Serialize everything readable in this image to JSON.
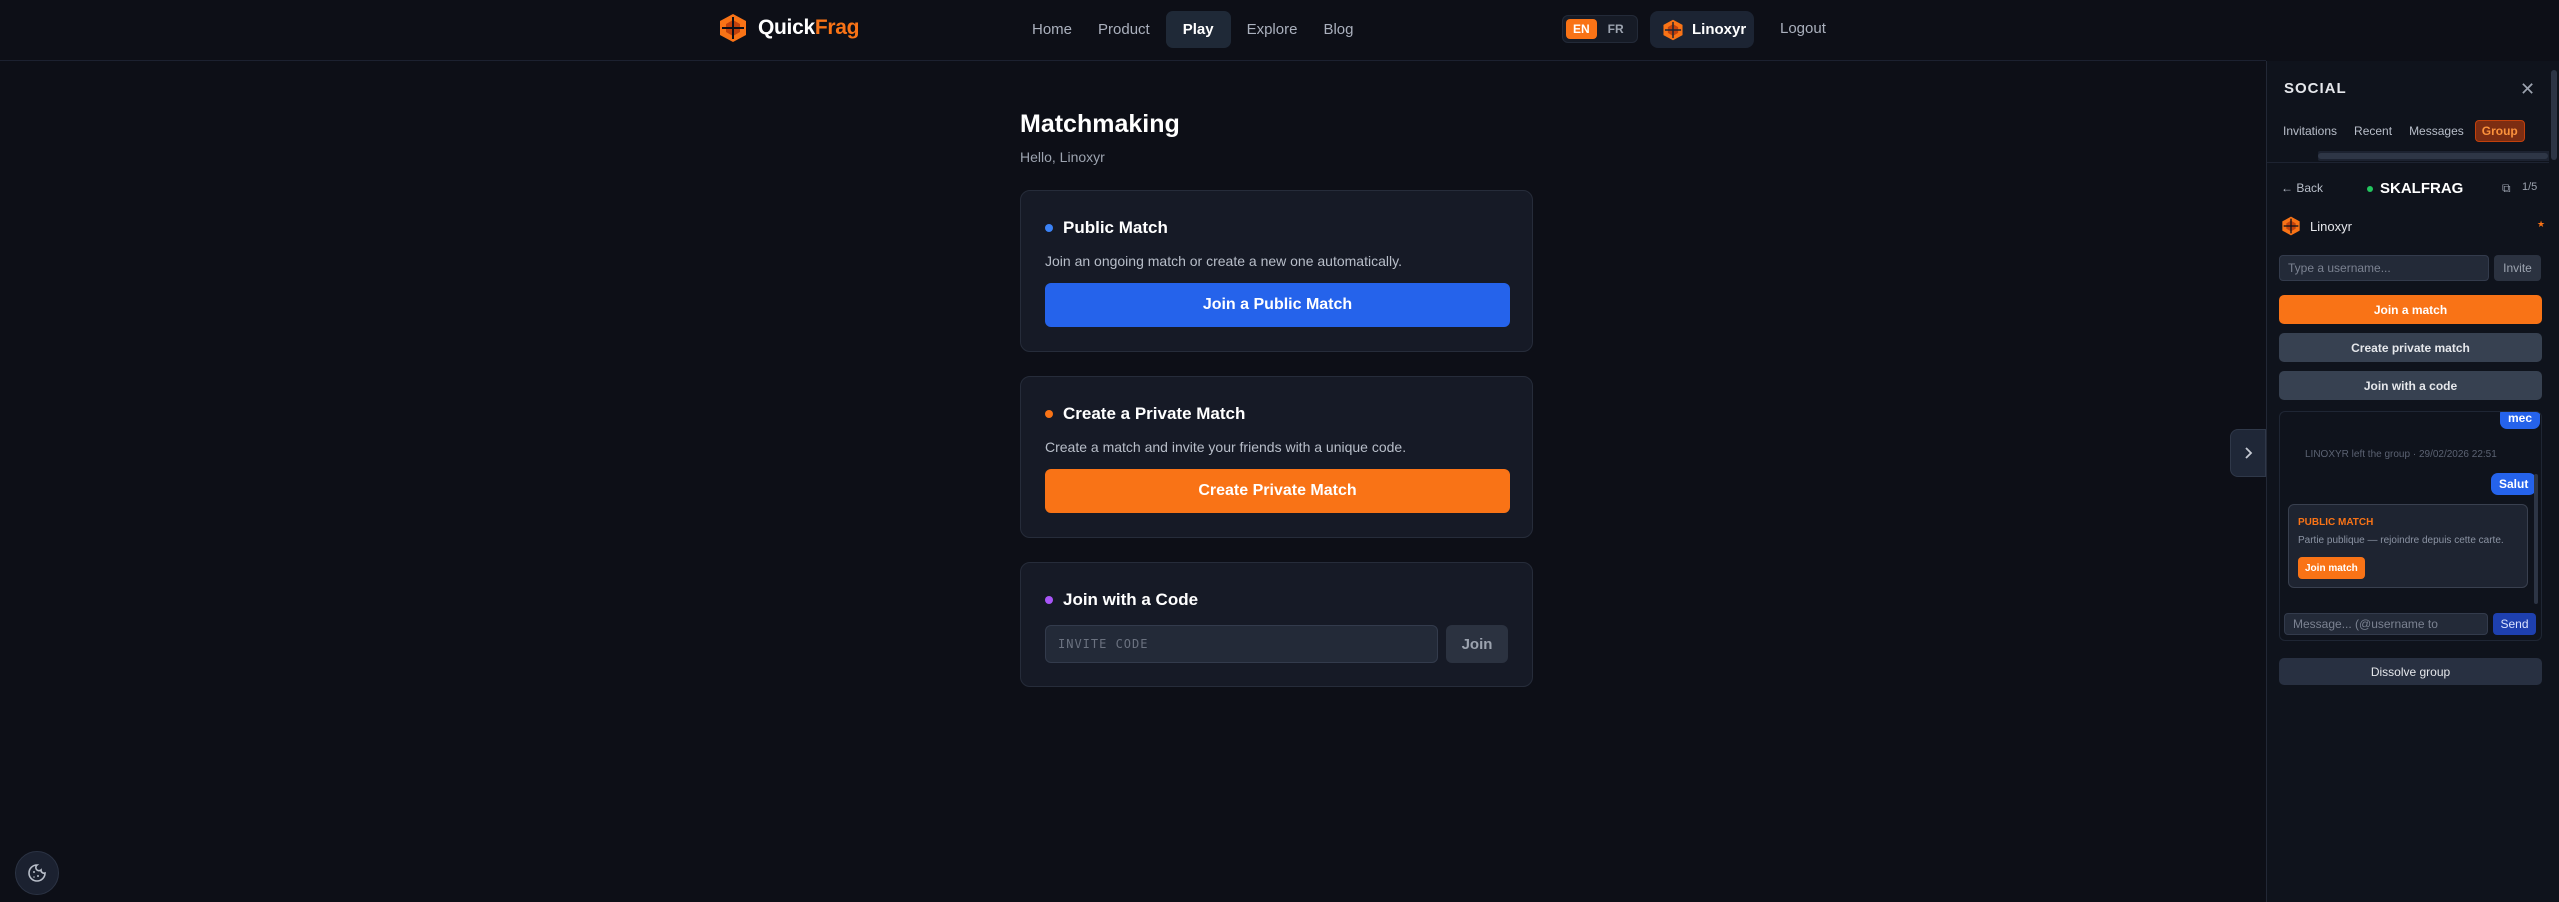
{
  "header": {
    "logo_text_a": "Quick",
    "logo_text_b": "Frag",
    "nav": [
      {
        "label": "Home"
      },
      {
        "label": "Product"
      },
      {
        "label": "Play"
      },
      {
        "label": "Explore"
      },
      {
        "label": "Blog"
      }
    ],
    "active_nav": "Play",
    "lang": {
      "en": "EN",
      "fr": "FR",
      "active": "EN"
    },
    "user": {
      "name": "Linoxyr"
    },
    "logout_label": "Logout"
  },
  "main": {
    "title": "Matchmaking",
    "greeting": "Hello, Linoxyr",
    "public": {
      "title": "Public Match",
      "description": "Join an ongoing match or create a new one automatically.",
      "button": "Join a Public Match",
      "dot_color": "#3b82f6"
    },
    "private": {
      "title": "Create a Private Match",
      "description": "Create a match and invite your friends with a unique code.",
      "button": "Create Private Match",
      "dot_color": "#f97316"
    },
    "code": {
      "title": "Join with a Code",
      "placeholder": "INVITE CODE",
      "button": "Join",
      "dot_color": "#a855f7"
    }
  },
  "social": {
    "title": "SOCIAL",
    "tabs": [
      {
        "label": "Invitations"
      },
      {
        "label": "Recent"
      },
      {
        "label": "Messages"
      },
      {
        "label": "Group"
      }
    ],
    "active_tab": "Group",
    "group": {
      "back_label": "← Back",
      "name": "SKALFRAG",
      "count": "1/5",
      "member_name": "Linoxyr",
      "leader_mark": "★",
      "invite_placeholder": "Type a username...",
      "invite_button": "Invite",
      "join_match": "Join a match",
      "create_private": "Create private match",
      "join_code": "Join with a code"
    },
    "chat": {
      "bubble_1": "mec",
      "system_message": "LINOXYR left the group · 29/02/2026 22:51",
      "bubble_2": "Salut",
      "card_title": "PUBLIC MATCH",
      "card_desc": "Partie publique — rejoindre depuis cette carte.",
      "card_button": "Join match",
      "message_placeholder": "Message... (@username to",
      "send_label": "Send"
    },
    "dissolve_label": "Dissolve group"
  },
  "colors": {
    "brand_orange": "#f97316",
    "action_blue": "#2563eb",
    "background": "#0d0f17"
  },
  "icons": {
    "logo": "quickfrag-hexagon-icon",
    "close": "close-icon",
    "toggle": "chevron-right-icon",
    "share": "external-link-icon",
    "cookie": "cookie-icon"
  }
}
